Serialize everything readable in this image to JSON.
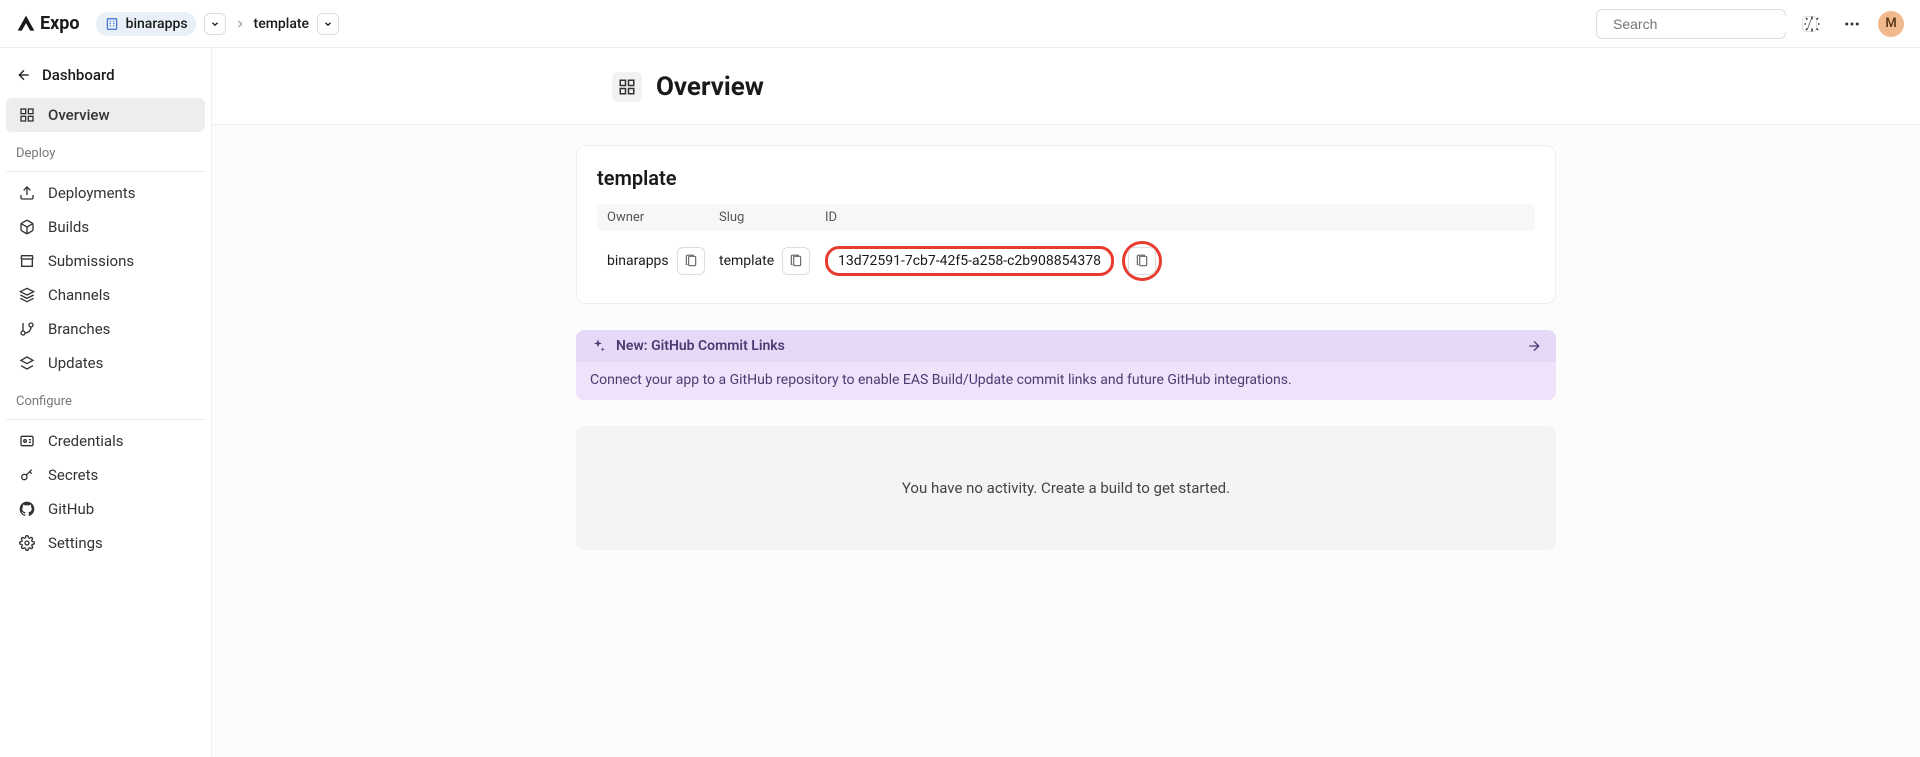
{
  "brand": "Expo",
  "breadcrumbs": {
    "org": "binarapps",
    "project": "template"
  },
  "search": {
    "placeholder": "Search",
    "shortcut": "/"
  },
  "avatar_initial": "M",
  "sidebar": {
    "back": "Dashboard",
    "items": [
      {
        "id": "overview",
        "label": "Overview",
        "active": true
      }
    ],
    "sections": [
      {
        "title": "Deploy",
        "items": [
          {
            "id": "deployments",
            "label": "Deployments"
          },
          {
            "id": "builds",
            "label": "Builds"
          },
          {
            "id": "submissions",
            "label": "Submissions"
          },
          {
            "id": "channels",
            "label": "Channels"
          },
          {
            "id": "branches",
            "label": "Branches"
          },
          {
            "id": "updates",
            "label": "Updates"
          }
        ]
      },
      {
        "title": "Configure",
        "items": [
          {
            "id": "credentials",
            "label": "Credentials"
          },
          {
            "id": "secrets",
            "label": "Secrets"
          },
          {
            "id": "github",
            "label": "GitHub"
          },
          {
            "id": "settings",
            "label": "Settings"
          }
        ]
      }
    ]
  },
  "page": {
    "title": "Overview",
    "project_name": "template",
    "columns": {
      "owner": "Owner",
      "slug": "Slug",
      "id": "ID"
    },
    "values": {
      "owner": "binarapps",
      "slug": "template",
      "id": "13d72591-7cb7-42f5-a258-c2b908854378"
    }
  },
  "banner": {
    "title": "New: GitHub Commit Links",
    "body": "Connect your app to a GitHub repository to enable EAS Build/Update commit links and future GitHub integrations."
  },
  "activity_empty": "You have no activity. Create a build to get started."
}
